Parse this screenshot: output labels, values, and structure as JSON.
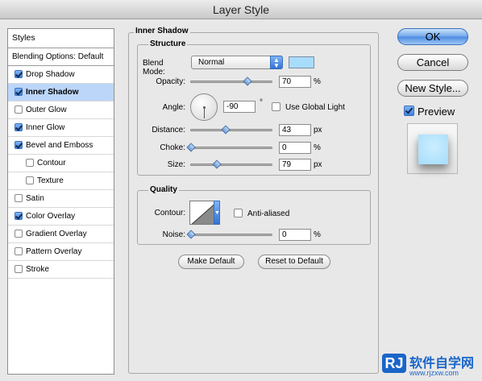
{
  "window": {
    "title": "Layer Style"
  },
  "sidebar": {
    "header": "Styles",
    "blending_options": "Blending Options: Default",
    "items": [
      {
        "label": "Drop Shadow",
        "checked": true,
        "selected": false,
        "sub": false
      },
      {
        "label": "Inner Shadow",
        "checked": true,
        "selected": true,
        "sub": false
      },
      {
        "label": "Outer Glow",
        "checked": false,
        "selected": false,
        "sub": false
      },
      {
        "label": "Inner Glow",
        "checked": true,
        "selected": false,
        "sub": false
      },
      {
        "label": "Bevel and Emboss",
        "checked": true,
        "selected": false,
        "sub": false
      },
      {
        "label": "Contour",
        "checked": false,
        "selected": false,
        "sub": true
      },
      {
        "label": "Texture",
        "checked": false,
        "selected": false,
        "sub": true
      },
      {
        "label": "Satin",
        "checked": false,
        "selected": false,
        "sub": false
      },
      {
        "label": "Color Overlay",
        "checked": true,
        "selected": false,
        "sub": false
      },
      {
        "label": "Gradient Overlay",
        "checked": false,
        "selected": false,
        "sub": false
      },
      {
        "label": "Pattern Overlay",
        "checked": false,
        "selected": false,
        "sub": false
      },
      {
        "label": "Stroke",
        "checked": false,
        "selected": false,
        "sub": false
      }
    ]
  },
  "panel": {
    "title": "Inner Shadow",
    "structure": {
      "title": "Structure",
      "blend_mode_label": "Blend Mode:",
      "blend_mode_value": "Normal",
      "shadow_color": "#a8dcfb",
      "opacity_label": "Opacity:",
      "opacity_value": "70",
      "opacity_fraction": 0.7,
      "percent_unit": "%",
      "angle_label": "Angle:",
      "angle_value": "-90",
      "degree_unit": "°",
      "use_global_light_label": "Use Global Light",
      "use_global_light_checked": false,
      "distance_label": "Distance:",
      "distance_value": "43",
      "distance_fraction": 0.43,
      "px_unit": "px",
      "choke_label": "Choke:",
      "choke_value": "0",
      "choke_fraction": 0,
      "size_label": "Size:",
      "size_value": "79",
      "size_fraction": 0.32
    },
    "quality": {
      "title": "Quality",
      "contour_label": "Contour:",
      "anti_aliased_label": "Anti-aliased",
      "anti_aliased_checked": false,
      "noise_label": "Noise:",
      "noise_value": "0",
      "noise_fraction": 0
    },
    "make_default_label": "Make Default",
    "reset_default_label": "Reset to Default"
  },
  "buttons": {
    "ok": "OK",
    "cancel": "Cancel",
    "new_style": "New Style...",
    "preview_label": "Preview",
    "preview_checked": true,
    "preview_color": "#a8dcfb"
  },
  "watermark": {
    "logo": "RJ",
    "text": "软件自学网",
    "url": "www.rjzxw.com"
  }
}
